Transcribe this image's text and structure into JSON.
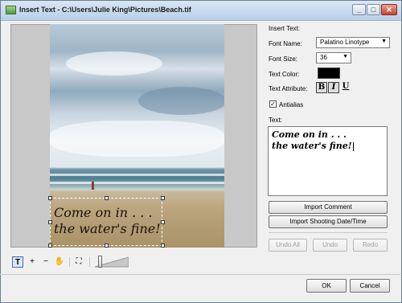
{
  "window": {
    "title": "Insert Text - C:\\Users\\Julie King\\Pictures\\Beach.tif"
  },
  "overlay": {
    "line1": "Come on in . . .",
    "line2": "the water's fine!"
  },
  "panel": {
    "section_label": "Insert Text:",
    "font_name_label": "Font Name:",
    "font_name_value": "Palatino Linotype",
    "font_size_label": "Font Size:",
    "font_size_value": "36",
    "text_color_label": "Text Color:",
    "text_color": "#000000",
    "text_attribute_label": "Text Attribute:",
    "bold_label": "B",
    "italic_label": "I",
    "underline_label": "U",
    "antialias_label": "Antialias",
    "antialias_checked": true,
    "text_label": "Text:",
    "text_line1": "Come on in . . .",
    "text_line2": "the water's fine!"
  },
  "buttons": {
    "import_comment": "Import Comment",
    "import_shooting": "Import Shooting Date/Time",
    "undo_all": "Undo All",
    "undo": "Undo",
    "redo": "Redo",
    "ok": "OK",
    "cancel": "Cancel"
  },
  "toolbar": {
    "tools": [
      "text-tool-icon",
      "zoom-in-icon",
      "zoom-out-icon",
      "hand-icon",
      "fit-to-window-icon"
    ],
    "text_tool_glyph": "T",
    "zoom_in_glyph": "+",
    "zoom_out_glyph": "−",
    "hand_glyph": "✋",
    "fit_glyph": "⛶"
  },
  "colors": {
    "accent": "#4a6aa5"
  }
}
